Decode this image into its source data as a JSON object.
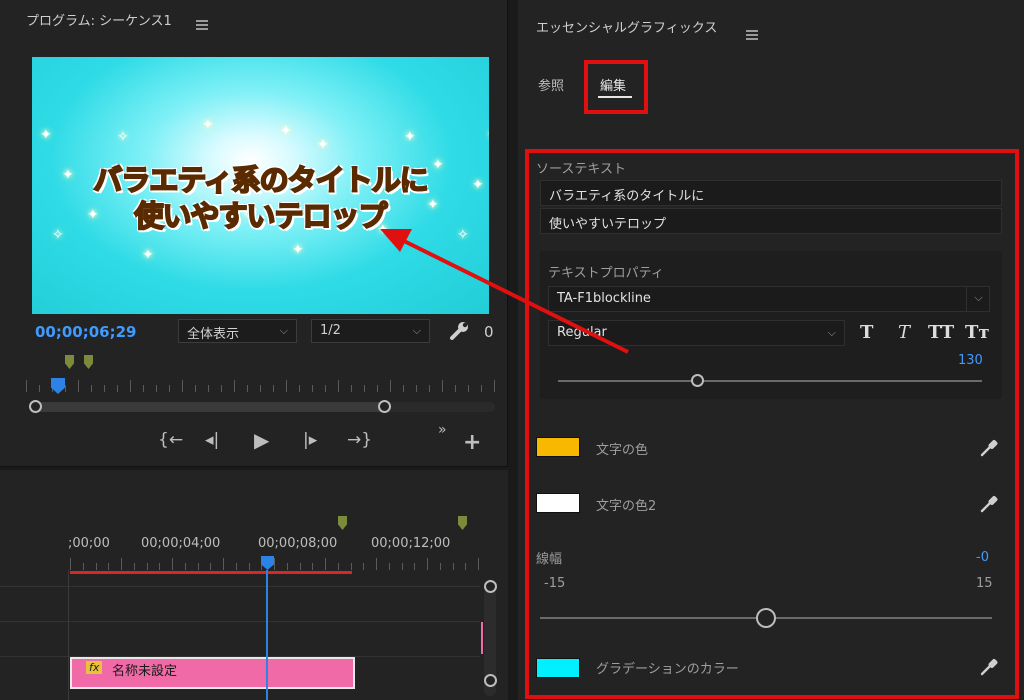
{
  "program_monitor": {
    "title": "プログラム: シーケンス1",
    "video_title_line1": "バラエティ系のタイトルに",
    "video_title_line2": "使いやすいテロップ",
    "timecode": "00;00;06;29",
    "zoom": "全体表示",
    "resolution": "1/2",
    "wrench_value": "0",
    "playhead_fraction": 0.07,
    "in_fraction": 0.0,
    "out_fraction": 0.77
  },
  "timeline": {
    "ruler_labels": [
      ";00;00",
      "00;00;04;00",
      "00;00;08;00",
      "00;00;12;00"
    ],
    "clip_name": "名称未設定",
    "clip_badge": "fx",
    "playhead_fraction": 0.48
  },
  "essential_graphics": {
    "title": "エッセンシャルグラフィックス",
    "tab_browse": "参照",
    "tab_edit": "編集",
    "source_text_label": "ソーステキスト",
    "source_line1": "バラエティ系のタイトルに",
    "source_line2": "使いやすいテロップ",
    "text_props_label": "テキストプロパティ",
    "font_name": "TA-F1blockline",
    "font_style": "Regular",
    "font_size": "130",
    "font_size_fraction": 0.33,
    "fill_color_label": "文字の色",
    "fill_color": "#f9b800",
    "fill2_color_label": "文字の色2",
    "fill2_color": "#ffffff",
    "stroke_width_label": "線幅",
    "stroke_width_value": "-0",
    "stroke_min": "-15",
    "stroke_max": "15",
    "stroke_fraction": 0.5,
    "gradient_label": "グラデーションのカラー",
    "gradient_color": "#00f0ff",
    "style_buttons": [
      "T",
      "T",
      "TT",
      "Tт"
    ]
  },
  "colors": {
    "accent_blue": "#3f9bff",
    "highlight_red": "#e01010",
    "clip_pink": "#f06aa8",
    "marker_green": "#7c8a3c"
  }
}
